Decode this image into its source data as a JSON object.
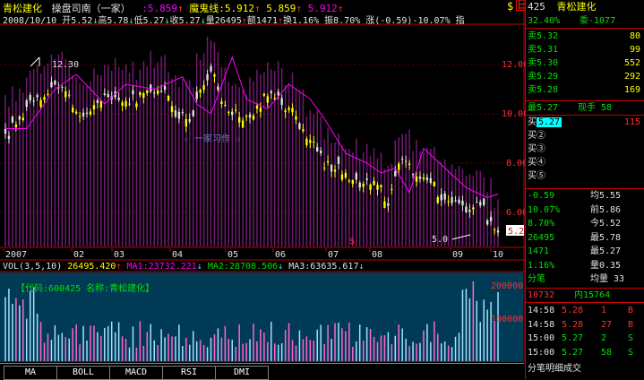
{
  "title": {
    "name": "青松建化",
    "author": "操盘司南（一家）",
    "ind1": ":5.859",
    "ind1_sym": "↑",
    "ind2": "魔鬼线:5.912",
    "ind2_sym": "↑",
    "ind3": "5.859",
    "ind3_sym": "↑",
    "ind4": "5.912",
    "ind4_sym": "↑"
  },
  "ohlc": {
    "date": "2008/10/10",
    "open": "开5.52",
    "open_sym": "↓",
    "high": "高5.78",
    "high_sym": "↓",
    "low": "低5.27",
    "low_sym": "↓",
    "close": "收5.27",
    "close_sym": "↓",
    "vol": "量26495",
    "vol_sym": "↑",
    "amt": "额1471",
    "amt_sym": "↑",
    "turnover": "换1.16%",
    "amp": "振8.70%",
    "chg": "涨(-0.59)-10.07%",
    "more": "指"
  },
  "price_axis": [
    "12.00",
    "10.00",
    "8.00",
    "6.00"
  ],
  "high_label": "12.30",
  "low_label": "5.0",
  "last_price": "5.27",
  "watermark": "☆ 一家习作 ☆",
  "date_axis": [
    "2007",
    "02",
    "03",
    "04",
    "05",
    "06",
    "07",
    "08",
    "09",
    "10"
  ],
  "period_label": "日线",
  "vol_bar": {
    "label": "VOL(3,5,10)",
    "v": "26495.420",
    "v_sym": "↑",
    "ma1": "MA1:23732.221",
    "ma1_sym": "↓",
    "ma2": "MA2:28708.506",
    "ma2_sym": "↓",
    "ma3": "MA3:63635.617",
    "ma3_sym": "↓"
  },
  "vol_info": "【代码:600425 名称:青松建化】",
  "vol_axis": [
    "200000",
    "100000"
  ],
  "tabs": [
    "MA",
    "BOLL",
    "MACD",
    "RSI",
    "DMI"
  ],
  "right": {
    "code": "425",
    "name": "青松建化",
    "weibi": "32.40%",
    "weicha": "委-1077",
    "asks": [
      {
        "label": "卖5.32",
        "vol": "80"
      },
      {
        "label": "卖5.31",
        "vol": "99"
      },
      {
        "label": "卖5.30",
        "vol": "552"
      },
      {
        "label": "卖5.29",
        "vol": "292"
      },
      {
        "label": "卖5.28",
        "vol": "169"
      }
    ],
    "last": "最5.27",
    "xianshou": "现手 58",
    "bid1_label": "买",
    "bid1_price": "5.27",
    "bid1_vol": "115",
    "bids": [
      "买②",
      "买③",
      "买④",
      "买⑤"
    ],
    "stats": [
      {
        "l": "-0.59",
        "r": "均5.55"
      },
      {
        "l": "10.07%",
        "r": "前5.86"
      },
      {
        "l": "8.70%",
        "r": "今5.52"
      },
      {
        "l": "26495",
        "r": "最5.78"
      },
      {
        "l": "1471",
        "r": "最5.27"
      },
      {
        "l": "1.16%",
        "r": "量0.35"
      },
      {
        "l": "分笔",
        "r": "均量 33"
      }
    ],
    "outer": "10732",
    "inner": "内15764",
    "ticks": [
      {
        "t": "14:58",
        "p": "5.28",
        "v": "1",
        "f": "B"
      },
      {
        "t": "14:58",
        "p": "5.28",
        "v": "27",
        "f": "B"
      },
      {
        "t": "15:00",
        "p": "5.27",
        "v": "2",
        "f": "S"
      },
      {
        "t": "15:00",
        "p": "5.27",
        "v": "58",
        "f": "S"
      }
    ],
    "tabs": "分笔明细成交"
  },
  "colors": {
    "up": "#ff3030",
    "down": "#00ffff",
    "candle_yellow": "#ffff00",
    "ma_line": "#ff00ff",
    "vol_bg": "#003a55"
  }
}
